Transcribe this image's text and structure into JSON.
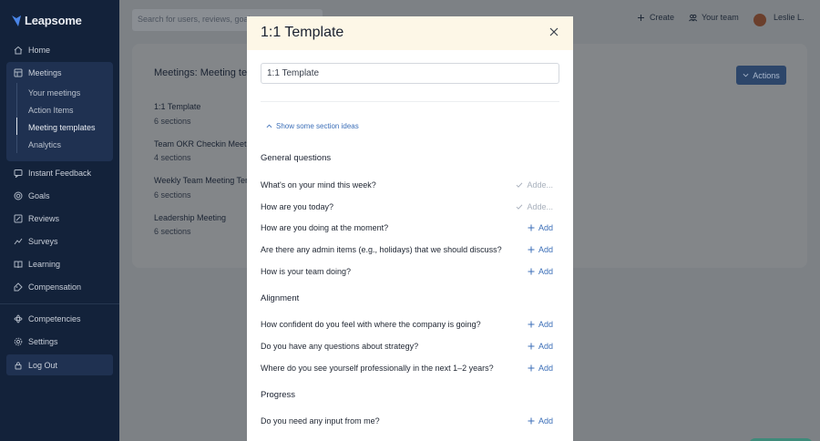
{
  "brand": {
    "name": "Leapsome"
  },
  "sidebar": {
    "items": [
      {
        "label": "Home",
        "icon": "home-icon"
      },
      {
        "label": "Meetings",
        "icon": "meetings-icon"
      },
      {
        "label": "Instant Feedback",
        "icon": "feedback-icon"
      },
      {
        "label": "Goals",
        "icon": "goals-icon"
      },
      {
        "label": "Reviews",
        "icon": "reviews-icon"
      },
      {
        "label": "Surveys",
        "icon": "surveys-icon"
      },
      {
        "label": "Learning",
        "icon": "learning-icon"
      },
      {
        "label": "Compensation",
        "icon": "compensation-icon"
      },
      {
        "label": "Competencies",
        "icon": "competencies-icon"
      },
      {
        "label": "Settings",
        "icon": "settings-icon"
      },
      {
        "label": "Log Out",
        "icon": "logout-icon"
      }
    ],
    "meetings_sub": [
      {
        "label": "Your meetings"
      },
      {
        "label": "Action Items"
      },
      {
        "label": "Meeting templates"
      },
      {
        "label": "Analytics"
      }
    ]
  },
  "topbar": {
    "search_placeholder": "Search for users, reviews, goals...",
    "create_label": "Create",
    "team_label": "Your team",
    "user_name": "Leslie L."
  },
  "page": {
    "title": "Meetings: Meeting templates",
    "actions_label": "Actions",
    "templates": [
      {
        "name": "1:1 Template",
        "sections": "6 sections"
      },
      {
        "name": "Team OKR Checkin Meeting",
        "sections": "4 sections"
      },
      {
        "name": "Weekly Team Meeting Template",
        "sections": "6 sections"
      },
      {
        "name": "Leadership Meeting",
        "sections": "6 sections"
      }
    ]
  },
  "modal": {
    "title": "1:1 Template",
    "name_value": "1:1 Template",
    "ideas_label": "Show some section ideas",
    "added_label": "Adde...",
    "add_label": "Add",
    "sections": [
      {
        "heading": "General questions",
        "questions": [
          {
            "text": "What's on your mind this week?",
            "state": "added"
          },
          {
            "text": "How are you today?",
            "state": "added"
          },
          {
            "text": "How are you doing at the moment?",
            "state": "add"
          },
          {
            "text": "Are there any admin items (e.g., holidays) that we should discuss?",
            "state": "add"
          },
          {
            "text": "How is your team doing?",
            "state": "add"
          }
        ]
      },
      {
        "heading": "Alignment",
        "questions": [
          {
            "text": "How confident do you feel with where the company is going?",
            "state": "add"
          },
          {
            "text": "Do you have any questions about strategy?",
            "state": "add"
          },
          {
            "text": "Where do you see yourself professionally in the next 1–2 years?",
            "state": "add"
          }
        ]
      },
      {
        "heading": "Progress",
        "questions": [
          {
            "text": "Do you need any input from me?",
            "state": "add"
          }
        ]
      }
    ]
  },
  "colors": {
    "accent": "#3c6fb8",
    "sidebar": "#13223a",
    "modal_header": "#fdf7e7"
  }
}
